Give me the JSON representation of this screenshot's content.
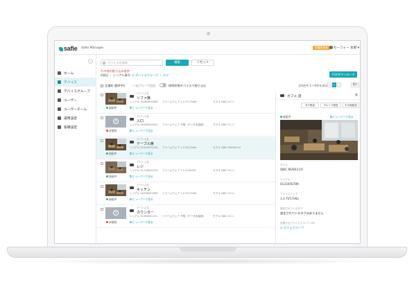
{
  "header": {
    "logo": "safie",
    "app_name": "Safie Manager",
    "org_badge": "組織管理者",
    "user": "セーフィー 太郎"
  },
  "sidebar": {
    "items": [
      {
        "label": "ホーム",
        "icon": "home-icon",
        "active": false
      },
      {
        "label": "デバイス",
        "icon": "camera-icon",
        "active": true
      },
      {
        "label": "デバイスグループ",
        "icon": "folder-icon",
        "active": false
      },
      {
        "label": "ユーザー",
        "icon": "user-icon",
        "active": false
      },
      {
        "label": "ユーザーチーム",
        "icon": "users-icon",
        "active": false
      },
      {
        "label": "運用設定",
        "icon": "settings-icon",
        "active": false
      },
      {
        "label": "各種設定",
        "icon": "gear-icon",
        "active": false
      }
    ]
  },
  "search": {
    "placeholder": "デバイスを検索",
    "search_button": "検索",
    "reset_button": "リセット",
    "filter_title": "その他の絞り込み条件",
    "filter_summary": "6項目 ・ シリアル番号",
    "filter_link": "◎ デバイスグループ ・ タグ",
    "download_button": "CSVダウンロード"
  },
  "toolbar": {
    "select_all": "全選択 選択中0",
    "edit_label": "一括グループ追加",
    "toggle_label": "接続状態デバイスで絞り込む",
    "range": "全6台中 1〜6件を表示",
    "pages": [
      "‹",
      "1",
      "›"
    ],
    "view": "表示"
  },
  "devices": [
    {
      "kind": "デバイス名",
      "name": "ソファ席",
      "online": true,
      "status": "録画中",
      "serial": "シリアル 00180001080",
      "fw": "ファームウェア 1.2.7t/17e6a",
      "model": "モデル QBiC CC-1",
      "viewer": "ビューアーで見る",
      "thumb": "cafe"
    },
    {
      "kind": "デバイス名",
      "name": "入口",
      "online": false,
      "status": "未接続",
      "serial": "シリアル 00180001031",
      "fw": "ファームウェア 不明（データ未接続）",
      "model": "モデル QBiC CC-1",
      "viewer": "ビューアーで見る",
      "thumb": "offline"
    },
    {
      "kind": "デバイス名",
      "name": "テーブル席",
      "online": true,
      "status": "録画中",
      "serial": "シリアル 01120031233",
      "fw": "ファームウェア 1.2.7t/17e6a",
      "model": "モデル QBiC M2003-10",
      "viewer": "ビューアーで見る",
      "thumb": "cafe2"
    },
    {
      "kind": "デバイス名",
      "name": "レジ",
      "online": true,
      "status": "録画中",
      "serial": "シリアル 01120031233",
      "fw": "ファームウェア 1.2.7m/b2f9",
      "model": "モデル QBiC CC-1",
      "viewer": "ビューアーで見る",
      "thumb": "cafe3"
    },
    {
      "kind": "デバイス名",
      "name": "キッチン",
      "online": true,
      "status": "録画中",
      "serial": "シリアル 00180001080",
      "fw": "ファームウェア 1.2.7t/17e6a",
      "model": "モデル QBiC CC-1",
      "viewer": "ビューアーで見る",
      "thumb": "cafe4"
    },
    {
      "kind": "デバイス名",
      "name": "カウンター",
      "online": false,
      "status": "未接続",
      "serial": "シリアル 01180001311",
      "fw": "ファームウェア 不明（データ未接続）",
      "model": "モデル QBiC CC-1",
      "viewer": "ビューアーで見る",
      "thumb": "offline"
    }
  ],
  "detail": {
    "title": "カフェ 店",
    "buttons": [
      "タグ設定",
      "グループ設定",
      "その他設定"
    ],
    "status": "録画中",
    "viewer": "ビューアーで見る",
    "fields": [
      {
        "label": "モデル",
        "value": "QBiC M2003-10"
      },
      {
        "label": "シリアル",
        "value": "0123456789"
      },
      {
        "label": "ファームウェア",
        "value": "1.2.7t/17e6a"
      },
      {
        "label": "設定されているタグ",
        "value": "設定されているタグはありません"
      },
      {
        "label": "所属するデバイスグループ 1件",
        "value": "◎ カフェグループ"
      }
    ]
  },
  "colors": {
    "accent": "#19a7b7",
    "online": "#2db67c",
    "offline": "#e0433a",
    "badge": "#f0a23a"
  }
}
